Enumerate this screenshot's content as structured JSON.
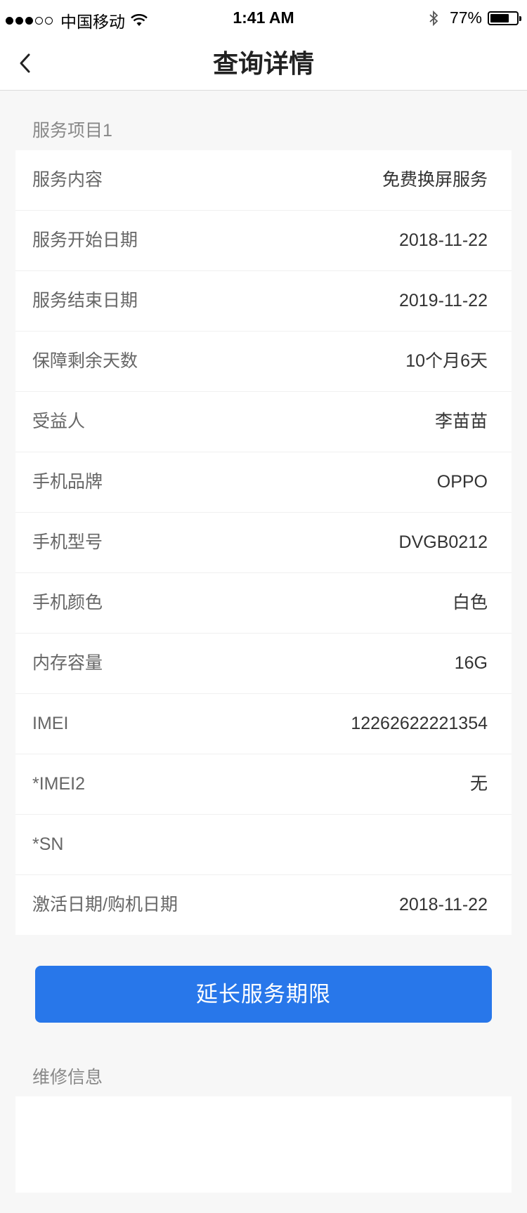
{
  "status_bar": {
    "carrier": "中国移动",
    "time": "1:41 AM",
    "battery": "77%",
    "battery_level": 0.77
  },
  "nav": {
    "title": "查询详情",
    "back_icon": "chevron-left-icon"
  },
  "service": {
    "section_title": "服务项目1",
    "rows": [
      {
        "label": "服务内容",
        "value": "免费换屏服务"
      },
      {
        "label": "服务开始日期",
        "value": "2018-11-22"
      },
      {
        "label": "服务结束日期",
        "value": "2019-11-22"
      },
      {
        "label": "保障剩余天数",
        "value": "10个月6天"
      },
      {
        "label": "受益人",
        "value": "李苗苗"
      },
      {
        "label": "手机品牌",
        "value": "OPPO"
      },
      {
        "label": "手机型号",
        "value": "DVGB0212"
      },
      {
        "label": "手机颜色",
        "value": "白色"
      },
      {
        "label": "内存容量",
        "value": "16G"
      },
      {
        "label": "IMEI",
        "value": "12262622221354"
      },
      {
        "label": "*IMEI2",
        "value": "无"
      },
      {
        "label": "*SN",
        "value": ""
      },
      {
        "label": "激活日期/购机日期",
        "value": "2018-11-22"
      }
    ]
  },
  "extend_button": {
    "label": "延长服务期限"
  },
  "repair": {
    "section_title": "维修信息"
  },
  "colors": {
    "accent": "#2877ea",
    "background": "#f7f7f7"
  }
}
